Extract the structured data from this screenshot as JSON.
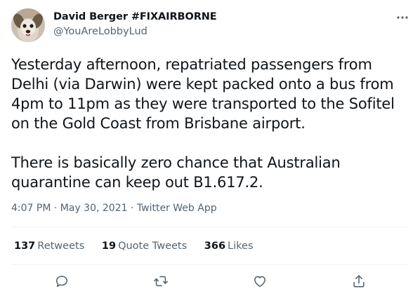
{
  "author": {
    "name": "David Berger #FIXAIRBORNE",
    "handle": "@YouAreLobbyLud",
    "avatar_icon": "dog-photo-avatar"
  },
  "more_icon": "more-horizontal-icon",
  "tweet": {
    "text": "Yesterday afternoon, repatriated passengers from Delhi (via Darwin) were kept packed onto a bus from 4pm to 11pm as they were transported to the Sofitel on the Gold Coast from Brisbane airport.\n\nThere is basically zero chance that Australian quarantine can keep out B1.617.2.",
    "time": "4:07 PM",
    "date": "May 30, 2021",
    "source": "Twitter Web App",
    "separator": "·"
  },
  "stats": {
    "retweets_count": "137",
    "retweets_label": "Retweets",
    "quotes_count": "19",
    "quotes_label": "Quote Tweets",
    "likes_count": "366",
    "likes_label": "Likes"
  },
  "actions": [
    {
      "icon": "reply-icon"
    },
    {
      "icon": "retweet-icon"
    },
    {
      "icon": "like-icon"
    },
    {
      "icon": "share-icon"
    }
  ],
  "colors": {
    "text": "#0f1419",
    "secondary": "#536471",
    "divider": "#eff3f4"
  }
}
